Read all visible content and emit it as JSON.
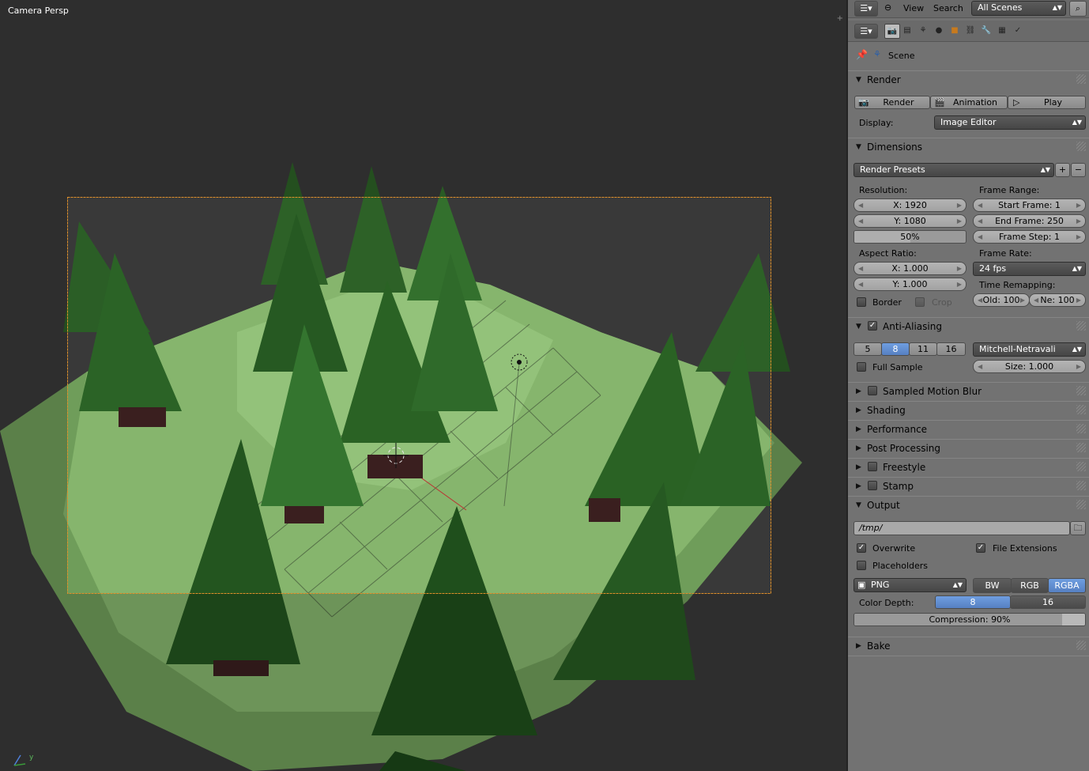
{
  "viewport": {
    "label": "Camera Persp",
    "axis_y": "y"
  },
  "header": {
    "menu_view": "View",
    "menu_search": "Search",
    "scenes_select": "All Scenes"
  },
  "context": {
    "scene_label": "Scene"
  },
  "render": {
    "title": "Render",
    "render_btn": "Render",
    "animation_btn": "Animation",
    "play_btn": "Play",
    "display_label": "Display:",
    "display_value": "Image Editor"
  },
  "dimensions": {
    "title": "Dimensions",
    "presets": "Render Presets",
    "resolution_label": "Resolution:",
    "res_x": "X: 1920",
    "res_y": "Y: 1080",
    "res_pct": "50%",
    "res_pct_value": 0.5,
    "frame_range_label": "Frame Range:",
    "start_frame": "Start Frame: 1",
    "end_frame": "End Frame: 250",
    "frame_step": "Frame Step: 1",
    "aspect_label": "Aspect Ratio:",
    "aspect_x": "X: 1.000",
    "aspect_y": "Y: 1.000",
    "frame_rate_label": "Frame Rate:",
    "frame_rate": "24 fps",
    "time_remap_label": "Time Remapping:",
    "remap_old": "Old: 100",
    "remap_new": "Ne: 100",
    "border": "Border",
    "crop": "Crop"
  },
  "antialiasing": {
    "title": "Anti-Aliasing",
    "samples": [
      "5",
      "8",
      "11",
      "16"
    ],
    "selected": "8",
    "filter": "Mitchell-Netravali",
    "full_sample": "Full Sample",
    "size": "Size: 1.000"
  },
  "collapsed_panels": {
    "motion_blur": "Sampled Motion Blur",
    "shading": "Shading",
    "performance": "Performance",
    "post_processing": "Post Processing",
    "freestyle": "Freestyle",
    "stamp": "Stamp"
  },
  "output": {
    "title": "Output",
    "path": "/tmp/",
    "overwrite": "Overwrite",
    "file_extensions": "File Extensions",
    "placeholders": "Placeholders",
    "format": "PNG",
    "modes": [
      "BW",
      "RGB",
      "RGBA"
    ],
    "selected_mode": "RGBA",
    "color_depth_label": "Color Depth:",
    "depths": [
      "8",
      "16"
    ],
    "selected_depth": "8",
    "compression": "Compression: 90%",
    "compression_value": 0.9
  },
  "bake": {
    "title": "Bake"
  },
  "colors": {
    "accent": "#5680c2",
    "background": "#393939",
    "panel": "#727272"
  }
}
